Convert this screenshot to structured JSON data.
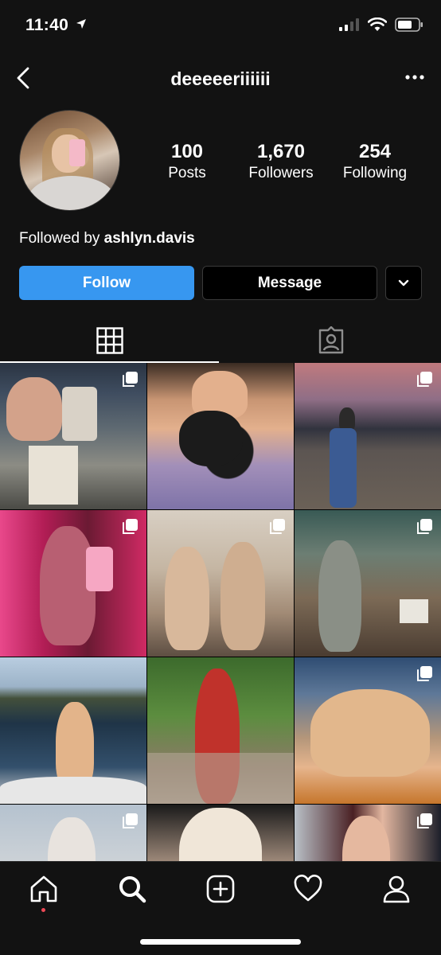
{
  "status_bar": {
    "time": "11:40",
    "icons": [
      "location-arrow-icon",
      "cellular-signal-icon",
      "wifi-icon",
      "battery-icon"
    ]
  },
  "header": {
    "username": "deeeeeriiiiii",
    "back_icon": "chevron-left-icon",
    "more_icon": "more-horizontal-icon"
  },
  "profile": {
    "stats": [
      {
        "value": "100",
        "label": "Posts"
      },
      {
        "value": "1,670",
        "label": "Followers"
      },
      {
        "value": "254",
        "label": "Following"
      }
    ],
    "followed_by_prefix": "Followed by",
    "followed_by_user": "ashlyn.davis"
  },
  "actions": {
    "follow_label": "Follow",
    "message_label": "Message",
    "dropdown_icon": "chevron-down-icon"
  },
  "tabs": [
    {
      "icon": "grid-icon",
      "active": true
    },
    {
      "icon": "tagged-icon",
      "active": false
    }
  ],
  "posts": [
    {
      "multiple": true
    },
    {
      "multiple": false
    },
    {
      "multiple": true
    },
    {
      "multiple": true
    },
    {
      "multiple": true
    },
    {
      "multiple": true
    },
    {
      "multiple": false
    },
    {
      "multiple": false
    },
    {
      "multiple": true
    },
    {
      "multiple": true
    },
    {
      "multiple": false
    },
    {
      "multiple": true
    }
  ],
  "bottom_nav": [
    {
      "icon": "home-icon",
      "has_notification": true
    },
    {
      "icon": "search-icon",
      "selected": true
    },
    {
      "icon": "new-post-icon"
    },
    {
      "icon": "heart-icon"
    },
    {
      "icon": "profile-icon"
    }
  ],
  "colors": {
    "background": "#000000",
    "surface": "#121212",
    "follow_button": "#3797f0",
    "notification_dot": "#ed4956"
  }
}
